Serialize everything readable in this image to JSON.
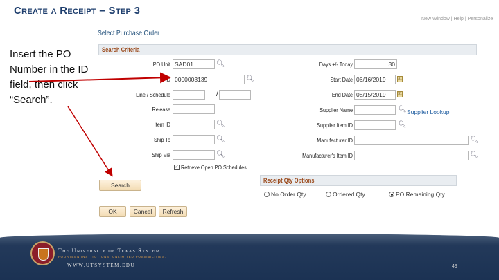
{
  "slide": {
    "title": "Create a Receipt – Step 3",
    "instruction": "Insert the PO Number in the ID field, then click “Search”.",
    "page_number": "49"
  },
  "header_links": "New Window | Help | Personalize",
  "page_title": "Select Purchase Order",
  "search_criteria": {
    "section_label": "Search Criteria",
    "po_unit": {
      "label": "PO Unit",
      "value": "SAD01"
    },
    "id": {
      "label": "ID",
      "value": "0000003139"
    },
    "line_schedule": {
      "label": "Line / Schedule",
      "separator": "/",
      "line": "",
      "schedule": ""
    },
    "release": {
      "label": "Release",
      "value": ""
    },
    "item_id": {
      "label": "Item ID",
      "value": ""
    },
    "ship_to": {
      "label": "Ship To",
      "value": ""
    },
    "ship_via": {
      "label": "Ship Via",
      "value": ""
    },
    "days_today": {
      "label": "Days +/- Today",
      "value": "30"
    },
    "start_date": {
      "label": "Start Date",
      "value": "06/16/2019"
    },
    "end_date": {
      "label": "End Date",
      "value": "08/15/2019"
    },
    "supplier_name": {
      "label": "Supplier Name",
      "value": ""
    },
    "supplier_lookup": "Supplier Lookup",
    "supplier_item_id": {
      "label": "Supplier Item ID",
      "value": ""
    },
    "manufacturer_id": {
      "label": "Manufacturer ID",
      "value": ""
    },
    "manufacturer_item_id": {
      "label": "Manufacturer's Item ID",
      "value": ""
    },
    "retrieve_open": {
      "label": "Retrieve Open PO Schedules",
      "checked": true
    }
  },
  "buttons": {
    "search": "Search",
    "ok": "OK",
    "cancel": "Cancel",
    "refresh": "Refresh"
  },
  "receipt_qty": {
    "section_label": "Receipt Qty Options",
    "options": [
      "No Order Qty",
      "Ordered Qty",
      "PO Remaining Qty"
    ],
    "selected": "PO Remaining Qty"
  },
  "footer": {
    "org": "The University of Texas System",
    "tagline": "FOURTEEN INSTITUTIONS. UNLIMITED POSSIBILITIES.",
    "url": "WWW.UTSYSTEM.EDU"
  },
  "colors": {
    "arrow": "#c00000",
    "footer": "#1b3253",
    "section_text": "#9b4a1c"
  }
}
